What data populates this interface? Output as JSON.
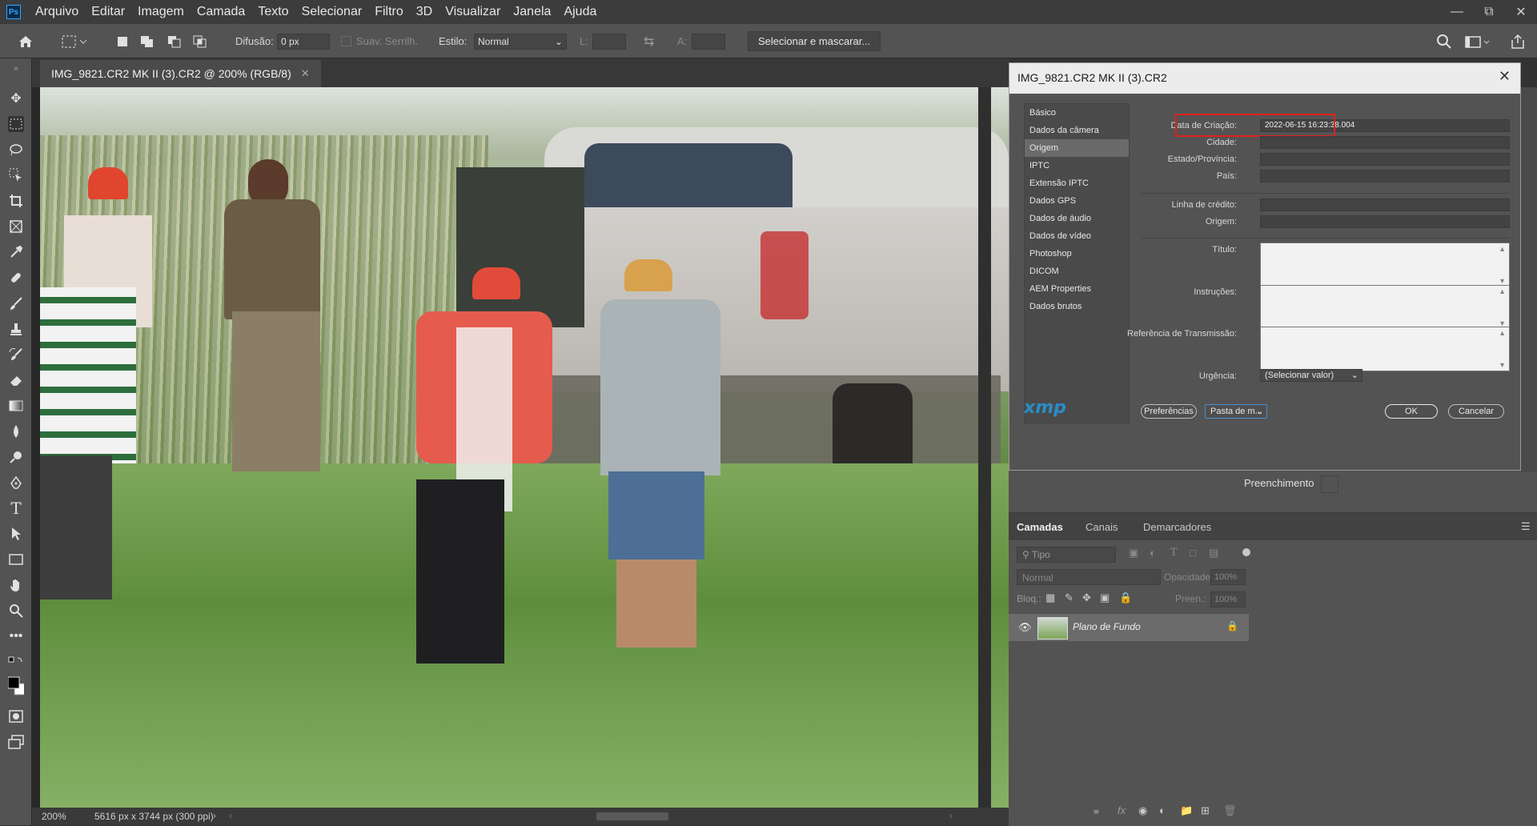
{
  "app": {
    "logo": "Ps"
  },
  "menu": [
    "Arquivo",
    "Editar",
    "Imagem",
    "Camada",
    "Texto",
    "Selecionar",
    "Filtro",
    "3D",
    "Visualizar",
    "Janela",
    "Ajuda"
  ],
  "options": {
    "difusao_label": "Difusão:",
    "difusao_value": "0 px",
    "suav_label": "Suav. Serrilh.",
    "estilo_label": "Estilo:",
    "estilo_value": "Normal",
    "l_label": "L:",
    "a_label": "A:",
    "select_mask_button": "Selecionar e mascarar..."
  },
  "document": {
    "tab_title": "IMG_9821.CR2 MK II (3).CR2 @ 200% (RGB/8)"
  },
  "status": {
    "zoom": "200%",
    "info": "5616 px x 3744 px (300 ppi)"
  },
  "dialog": {
    "title": "IMG_9821.CR2 MK II (3).CR2",
    "categories": [
      "Básico",
      "Dados da câmera",
      "Origem",
      "IPTC",
      "Extensão IPTC",
      "Dados GPS",
      "Dados de áudio",
      "Dados de vídeo",
      "Photoshop",
      "DICOM",
      "AEM Properties",
      "Dados brutos"
    ],
    "selected_category": "Origem",
    "fields": {
      "data_criacao_label": "Data de Criação:",
      "data_criacao_value": "2022-06-15 16:23:38.004",
      "cidade_label": "Cidade:",
      "estado_label": "Estado/Província:",
      "pais_label": "País:",
      "credito_label": "Linha de crédito:",
      "origem_label": "Origem:",
      "titulo_label": "Título:",
      "instrucoes_label": "Instruções:",
      "referencia_label": "Referência de Transmissão:",
      "urgencia_label": "Urgência:",
      "urgencia_value": "(Selecionar valor)"
    },
    "buttons": {
      "preferencias": "Preferências",
      "pasta": "Pasta de m...",
      "ok": "OK",
      "cancelar": "Cancelar"
    },
    "xmp_logo": "xmp"
  },
  "panels": {
    "preenchimento": "Preenchimento",
    "tabs": [
      "Camadas",
      "Canais",
      "Demarcadores"
    ],
    "search_placeholder": "Tipo",
    "blend_mode": "Normal",
    "opacity_label": "Opacidade:",
    "opacity_value": "100%",
    "lock_label": "Bloq.:",
    "fill_label": "Preen.:",
    "fill_value": "100%",
    "layer_name": "Plano de Fundo"
  }
}
